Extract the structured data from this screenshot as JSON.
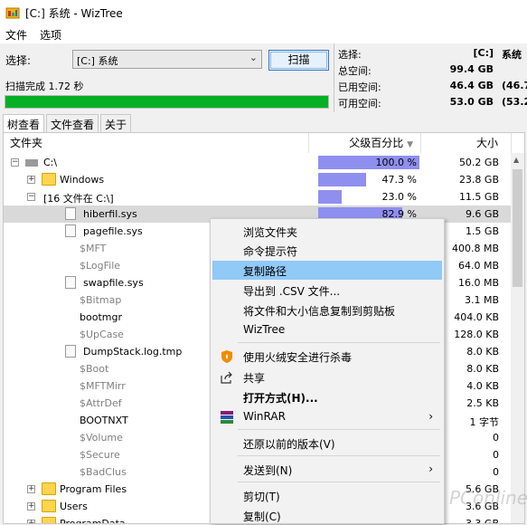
{
  "window": {
    "title": "[C:] 系统 - WizTree"
  },
  "menu": {
    "file": "文件",
    "options": "选项"
  },
  "toolbar": {
    "select_label": "选择:",
    "drive_value": "[C:] 系统",
    "scan_button": "扫描",
    "scan_status": "扫描完成 1.72 秒",
    "progress": 1.0
  },
  "stats": {
    "select_label": "选择:",
    "select_value": "[C:]",
    "select_value2": "系统",
    "total_label": "总空间:",
    "total_value": "99.4 GB",
    "used_label": "已用空间:",
    "used_value": "46.4 GB",
    "used_pct": "(46.7",
    "free_label": "可用空间:",
    "free_value": "53.0 GB",
    "free_pct": "(53.2"
  },
  "tabs": [
    "树查看",
    "文件查看",
    "关于"
  ],
  "columns": {
    "folder": "文件夹",
    "parent_pct": "父级百分比",
    "size": "大小"
  },
  "rows": [
    {
      "name": "C:\\",
      "pct": "100.0 %",
      "pct_value": 100.0,
      "size": "50.2 GB"
    },
    {
      "name": "Windows",
      "pct": "47.3 %",
      "pct_value": 47.3,
      "size": "23.8 GB"
    },
    {
      "name": "[16 文件在 C:\\]",
      "pct": "23.0 %",
      "pct_value": 23.0,
      "size": "11.5 GB"
    },
    {
      "name": "hiberfil.sys",
      "pct": "82.9 %",
      "pct_value": 82.9,
      "size": "9.6 GB"
    },
    {
      "name": "pagefile.sys",
      "size": "1.5 GB"
    },
    {
      "name": "$MFT",
      "size": "400.8 MB"
    },
    {
      "name": "$LogFile",
      "size": "64.0 MB"
    },
    {
      "name": "swapfile.sys",
      "size": "16.0 MB"
    },
    {
      "name": "$Bitmap",
      "size": "3.1 MB"
    },
    {
      "name": "bootmgr",
      "size": "404.0 KB"
    },
    {
      "name": "$UpCase",
      "size": "128.0 KB"
    },
    {
      "name": "DumpStack.log.tmp",
      "size": "8.0 KB"
    },
    {
      "name": "$Boot",
      "size": "8.0 KB"
    },
    {
      "name": "$MFTMirr",
      "size": "4.0 KB"
    },
    {
      "name": "$AttrDef",
      "size": "2.5 KB"
    },
    {
      "name": "BOOTNXT",
      "size": "1 字节"
    },
    {
      "name": "$Volume",
      "size": "0"
    },
    {
      "name": "$Secure",
      "size": "0"
    },
    {
      "name": "$BadClus",
      "size": "0"
    },
    {
      "name": "Program Files",
      "size": "5.6 GB"
    },
    {
      "name": "Users",
      "size": "3.6 GB"
    },
    {
      "name": "ProgramData",
      "size": "3.3 GB"
    }
  ],
  "context_menu": [
    "浏览文件夹",
    "命令提示符",
    "复制路径",
    "导出到 .CSV 文件...",
    "将文件和大小信息复制到剪贴板",
    "WizTree",
    "使用火绒安全进行杀毒",
    "共享",
    "打开方式(H)...",
    "WinRAR",
    "还原以前的版本(V)",
    "发送到(N)",
    "剪切(T)",
    "复制(C)"
  ],
  "watermark": "PConline",
  "colors": {
    "progress": "#06b025",
    "pct_bar": "#8f8ff0",
    "menu_highlight": "#91c9f7"
  }
}
